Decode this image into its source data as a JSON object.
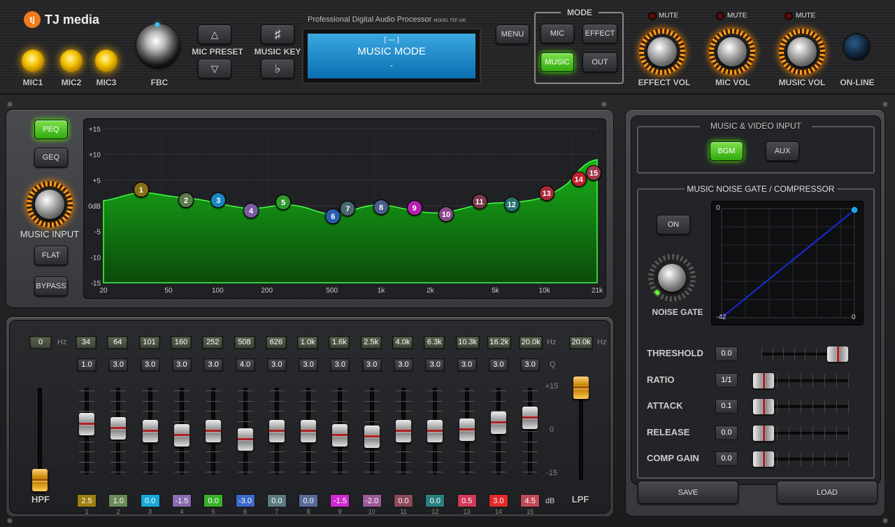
{
  "brand": {
    "logo_text": "TJ media"
  },
  "mics": [
    {
      "label": "MIC1"
    },
    {
      "label": "MIC2"
    },
    {
      "label": "MIC3"
    }
  ],
  "fbc": {
    "label": "FBC"
  },
  "mic_preset": {
    "label": "MIC PRESET"
  },
  "music_key": {
    "label": "MUSIC KEY",
    "sharp": "♯",
    "flat": "♭"
  },
  "display": {
    "header": "Professional Digital Audio Processor",
    "model": "MODEL TEF-100",
    "line1": "[ --- ]",
    "line2": "MUSIC MODE",
    "line3": "-"
  },
  "menu": {
    "label": "MENU"
  },
  "mode": {
    "title": "MODE",
    "buttons": [
      "MIC",
      "EFFECT",
      "MUSIC",
      "OUT"
    ],
    "active": "MUSIC"
  },
  "volumes": [
    {
      "label": "EFFECT VOL",
      "mute": "MUTE"
    },
    {
      "label": "MIC VOL",
      "mute": "MUTE"
    },
    {
      "label": "MUSIC VOL",
      "mute": "MUTE"
    }
  ],
  "online": {
    "label": "ON-LINE"
  },
  "eq_side": {
    "peq": "PEQ",
    "geq": "GEQ",
    "input_label": "MUSIC INPUT",
    "flat": "FLAT",
    "bypass": "BYPASS",
    "active": "PEQ"
  },
  "eq_graph": {
    "y_ticks": [
      "+15",
      "+10",
      "+5",
      "0dB",
      "-5",
      "-10",
      "-15"
    ],
    "x_ticks": [
      "20",
      "50",
      "100",
      "200",
      "500",
      "1k",
      "2k",
      "5k",
      "10k",
      "21k"
    ],
    "curve_color": "#19b019",
    "bands": [
      {
        "n": "1",
        "color": "#8a6e14"
      },
      {
        "n": "2",
        "color": "#5d7a4a"
      },
      {
        "n": "3",
        "color": "#1a86c4"
      },
      {
        "n": "4",
        "color": "#7a5aa0"
      },
      {
        "n": "5",
        "color": "#2f9a2a"
      },
      {
        "n": "6",
        "color": "#2a5fb0"
      },
      {
        "n": "7",
        "color": "#4a6870"
      },
      {
        "n": "8",
        "color": "#4a5e8a"
      },
      {
        "n": "9",
        "color": "#b020b0"
      },
      {
        "n": "10",
        "color": "#8a4a8a"
      },
      {
        "n": "11",
        "color": "#7a3a4a"
      },
      {
        "n": "12",
        "color": "#2a7070"
      },
      {
        "n": "13",
        "color": "#a82a3a"
      },
      {
        "n": "14",
        "color": "#c02030"
      },
      {
        "n": "15",
        "color": "#a03a4a"
      }
    ]
  },
  "faders": {
    "hpf": {
      "label": "HPF",
      "value": "0",
      "unit": "Hz"
    },
    "lpf": {
      "label": "LPF",
      "value": "20.0k",
      "unit": "Hz"
    },
    "q_unit": "Q",
    "db_unit": "dB",
    "scale": [
      "+15",
      "0",
      "-15"
    ],
    "bands": [
      {
        "freq": "34",
        "q": "1.0",
        "gain": "2.5",
        "gain_val": 2.5,
        "color": "#a07e10",
        "num": "1"
      },
      {
        "freq": "64",
        "q": "3.0",
        "gain": "1.0",
        "gain_val": 1.0,
        "color": "#6a8a5a",
        "num": "2"
      },
      {
        "freq": "101",
        "q": "3.0",
        "gain": "0.0",
        "gain_val": 0.0,
        "color": "#18a8d8",
        "num": "3"
      },
      {
        "freq": "160",
        "q": "3.0",
        "gain": "-1.5",
        "gain_val": -1.5,
        "color": "#8a6ab0",
        "num": "4"
      },
      {
        "freq": "252",
        "q": "3.0",
        "gain": "0.0",
        "gain_val": 0.0,
        "color": "#3ab02a",
        "num": "5"
      },
      {
        "freq": "508",
        "q": "4.0",
        "gain": "-3.0",
        "gain_val": -3.0,
        "color": "#3a6ac8",
        "num": "6"
      },
      {
        "freq": "626",
        "q": "3.0",
        "gain": "0.0",
        "gain_val": 0.0,
        "color": "#5a7a80",
        "num": "7"
      },
      {
        "freq": "1.0k",
        "q": "3.0",
        "gain": "0.0",
        "gain_val": 0.0,
        "color": "#5a6a9a",
        "num": "8"
      },
      {
        "freq": "1.6k",
        "q": "3.0",
        "gain": "-1.5",
        "gain_val": -1.5,
        "color": "#d02ad0",
        "num": "9"
      },
      {
        "freq": "2.5k",
        "q": "3.0",
        "gain": "-2.0",
        "gain_val": -2.0,
        "color": "#9a5a9a",
        "num": "10"
      },
      {
        "freq": "4.0k",
        "q": "3.0",
        "gain": "0.0",
        "gain_val": 0.0,
        "color": "#8a4a5a",
        "num": "11"
      },
      {
        "freq": "6.3k",
        "q": "3.0",
        "gain": "0.0",
        "gain_val": 0.0,
        "color": "#2a8080",
        "num": "12"
      },
      {
        "freq": "10.3k",
        "q": "3.0",
        "gain": "0.5",
        "gain_val": 0.5,
        "color": "#d03a5a",
        "num": "13"
      },
      {
        "freq": "16.2k",
        "q": "3.0",
        "gain": "3.0",
        "gain_val": 3.0,
        "color": "#e02a2a",
        "num": "14"
      },
      {
        "freq": "20.0k",
        "q": "3.0",
        "gain": "4.5",
        "gain_val": 4.5,
        "color": "#c04a5a",
        "num": "15"
      }
    ]
  },
  "video_input": {
    "title": "MUSIC & VIDEO INPUT",
    "bgm": "BGM",
    "aux": "AUX",
    "active": "BGM"
  },
  "gate": {
    "title": "MUSIC NOISE GATE / COMPRESSOR",
    "on": "ON",
    "knob_label": "NOISE GATE",
    "graph_top": "0",
    "graph_bottom_left": "-42",
    "graph_bottom_right": "0"
  },
  "comp": [
    {
      "label": "THRESHOLD",
      "value": "0.0",
      "level": 1.0
    },
    {
      "label": "RATIO",
      "value": "1/1",
      "level": 0.0
    },
    {
      "label": "ATTACK",
      "value": "0.1",
      "level": 0.0
    },
    {
      "label": "RELEASE",
      "value": "0.0",
      "level": 0.0
    },
    {
      "label": "COMP GAIN",
      "value": "0.0",
      "level": 0.0
    }
  ],
  "actions": {
    "save": "SAVE",
    "load": "LOAD"
  }
}
